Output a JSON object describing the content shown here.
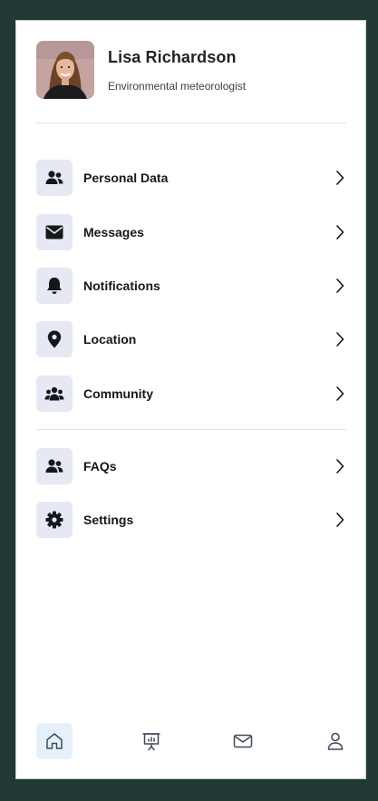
{
  "profile": {
    "name": "Lisa Richardson",
    "role": "Environmental meteorologist"
  },
  "menu": {
    "primary": [
      {
        "label": "Personal Data",
        "icon": "users-icon"
      },
      {
        "label": "Messages",
        "icon": "envelope-icon"
      },
      {
        "label": "Notifications",
        "icon": "bell-icon"
      },
      {
        "label": "Location",
        "icon": "map-pin-icon"
      },
      {
        "label": "Community",
        "icon": "group-icon"
      }
    ],
    "secondary": [
      {
        "label": "FAQs",
        "icon": "users-icon"
      },
      {
        "label": "Settings",
        "icon": "gear-icon"
      }
    ]
  },
  "bottom_nav": [
    {
      "icon": "home-icon",
      "active": true
    },
    {
      "icon": "presentation-chart-icon",
      "active": false
    },
    {
      "icon": "envelope-outline-icon",
      "active": false
    },
    {
      "icon": "user-icon",
      "active": false
    }
  ],
  "colors": {
    "background": "#213a36",
    "icon_box": "#e6e8f3",
    "active_nav": "#e6f0fb",
    "icon": "#15181b",
    "nav_icon": "#3d4a57"
  }
}
